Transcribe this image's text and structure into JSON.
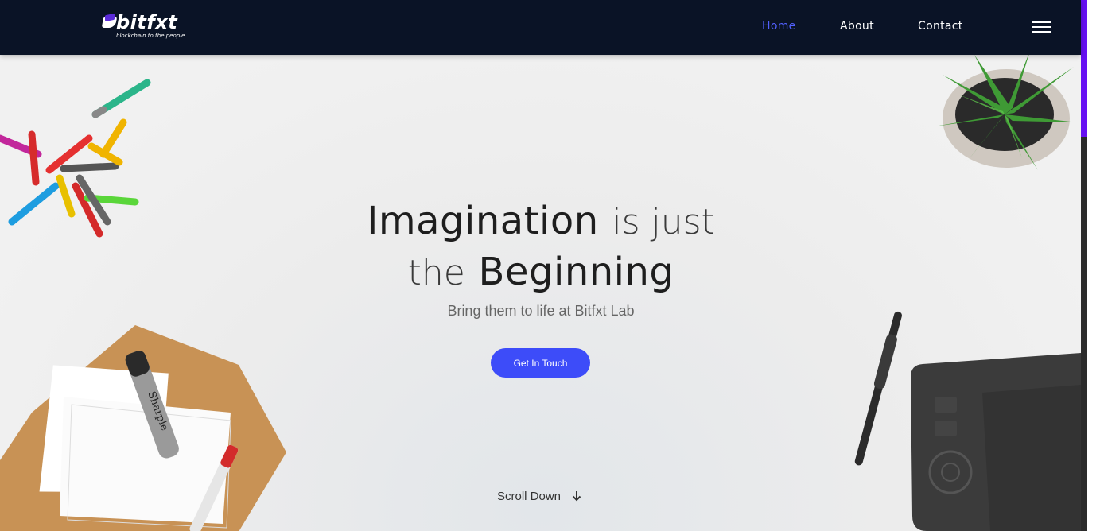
{
  "header": {
    "logo_text": "bitfxt",
    "logo_tagline": "blockchain to the people",
    "nav": [
      {
        "label": "Home",
        "active": true
      },
      {
        "label": "About",
        "active": false
      },
      {
        "label": "Contact",
        "active": false
      }
    ],
    "menu_icon": "hamburger-menu-icon"
  },
  "hero": {
    "headline_strong_1": "Imagination",
    "headline_light_1": "is just",
    "headline_light_2": "the",
    "headline_strong_2": "Beginning",
    "subheadline": "Bring them to life at Bitfxt Lab",
    "cta_label": "Get In Touch",
    "scroll_label": "Scroll Down",
    "scroll_icon": "arrow-down-icon"
  },
  "colors": {
    "nav_bg": "#0a1326",
    "accent": "#3d4cf9",
    "active_link": "#5261ff",
    "scroll_thumb": "#6610f2"
  }
}
